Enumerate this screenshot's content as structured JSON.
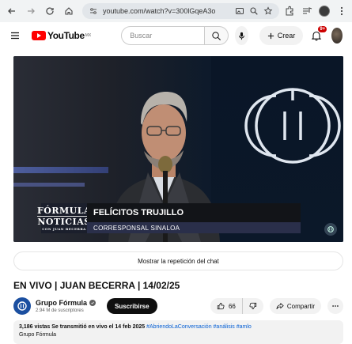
{
  "browser": {
    "url": "youtube.com/watch?v=300lGqeA3o"
  },
  "header": {
    "logo_text": "YouTube",
    "logo_region": "MX",
    "search_placeholder": "Buscar",
    "create_label": "Crear",
    "notification_count": "9+"
  },
  "player": {
    "lower_third_logo_line1": "FÓRMULA",
    "lower_third_logo_line2": "NOTICIAS",
    "lower_third_logo_line3": "CON JUAN BECERRA",
    "name": "FELÍCITOS TRUJILLO",
    "role": "CORRESPONSAL SINALOA"
  },
  "chat_replay_label": "Mostrar la repetición del chat",
  "video": {
    "title": "EN VIVO | JUAN BECERRA | 14/02/25"
  },
  "channel": {
    "name": "Grupo Fórmula",
    "subscribers": "2.94 M de suscriptores",
    "subscribe_label": "Suscribirse"
  },
  "actions": {
    "likes": "66",
    "share_label": "Compartir"
  },
  "description": {
    "meta": "3,186 vistas  Se transmitió en vivo el 14 feb 2025",
    "tags": "#AbriendoLaConversación #análisis #amlo",
    "line2": "Grupo Fórmula"
  },
  "colors": {
    "brand_red": "#ff0000",
    "link_blue": "#065fd4",
    "lower_third_blue": "#2a2f4a"
  }
}
